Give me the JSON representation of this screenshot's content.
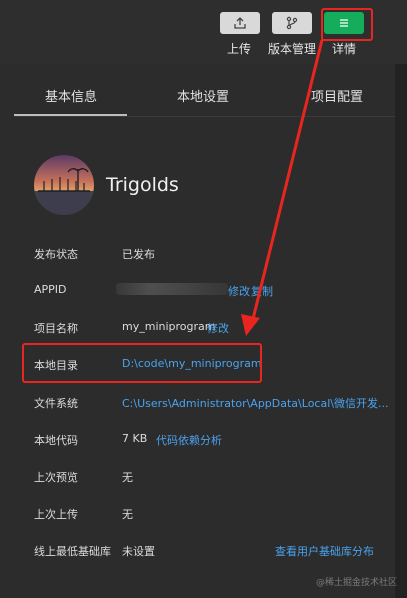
{
  "toolbar": {
    "buttons": [
      {
        "label": "上传",
        "icon": "upload-icon"
      },
      {
        "label": "版本管理",
        "icon": "branch-icon"
      },
      {
        "label": "详情",
        "icon": "menu-icon"
      }
    ]
  },
  "tabs": [
    "基本信息",
    "本地设置",
    "项目配置"
  ],
  "project": {
    "name": "Trigolds"
  },
  "details": [
    {
      "label": "发布状态",
      "value": "已发布"
    },
    {
      "label": "APPID",
      "value": "",
      "links": [
        "修改",
        "复制"
      ]
    },
    {
      "label": "项目名称",
      "value": "my_miniprogram",
      "link": "修改"
    },
    {
      "label": "本地目录",
      "value": "D:\\code\\my_miniprogram"
    },
    {
      "label": "文件系统",
      "value": "C:\\Users\\Administrator\\AppData\\Local\\微信开发..."
    },
    {
      "label": "本地代码",
      "value": "7 KB",
      "link": "代码依赖分析"
    },
    {
      "label": "上次预览",
      "value": "无"
    },
    {
      "label": "上次上传",
      "value": "无"
    },
    {
      "label": "线上最低基础库",
      "value": "未设置",
      "link": "查看用户基础库分布"
    }
  ],
  "watermark": "@稀土掘金技术社区",
  "colors": {
    "accent_green": "#15ad5c",
    "link": "#4aa3ef",
    "highlight": "#e8261f",
    "background": "#2c2c2c"
  }
}
